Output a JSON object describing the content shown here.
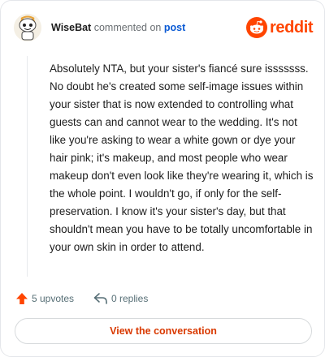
{
  "header": {
    "username": "WiseBat",
    "action_text": "commented on",
    "link_text": "post",
    "avatar_icon": "snoo-avatar-icon",
    "brand": "reddit",
    "brand_color": "#ff4500"
  },
  "comment": {
    "text": "Absolutely NTA, but your sister's fiancé sure isssssss. No doubt he's created some self-image issues within your sister that is now extended to controlling what guests can and cannot wear to the wedding. It's not like you're asking to wear a white gown or dye your hair pink; it's makeup, and most people who wear makeup don't even look like they're wearing it, which is the whole point. I wouldn't go, if only for the self-preservation. I know it's your sister's day, but that shouldn't mean you have to be totally uncomfortable in your own skin in order to attend."
  },
  "stats": {
    "upvotes": "5 upvotes",
    "replies": "0 replies",
    "upvote_icon": "upvote-arrow-icon",
    "reply_icon": "reply-arrow-icon"
  },
  "cta": {
    "label": "View the conversation",
    "color": "#d93900"
  }
}
